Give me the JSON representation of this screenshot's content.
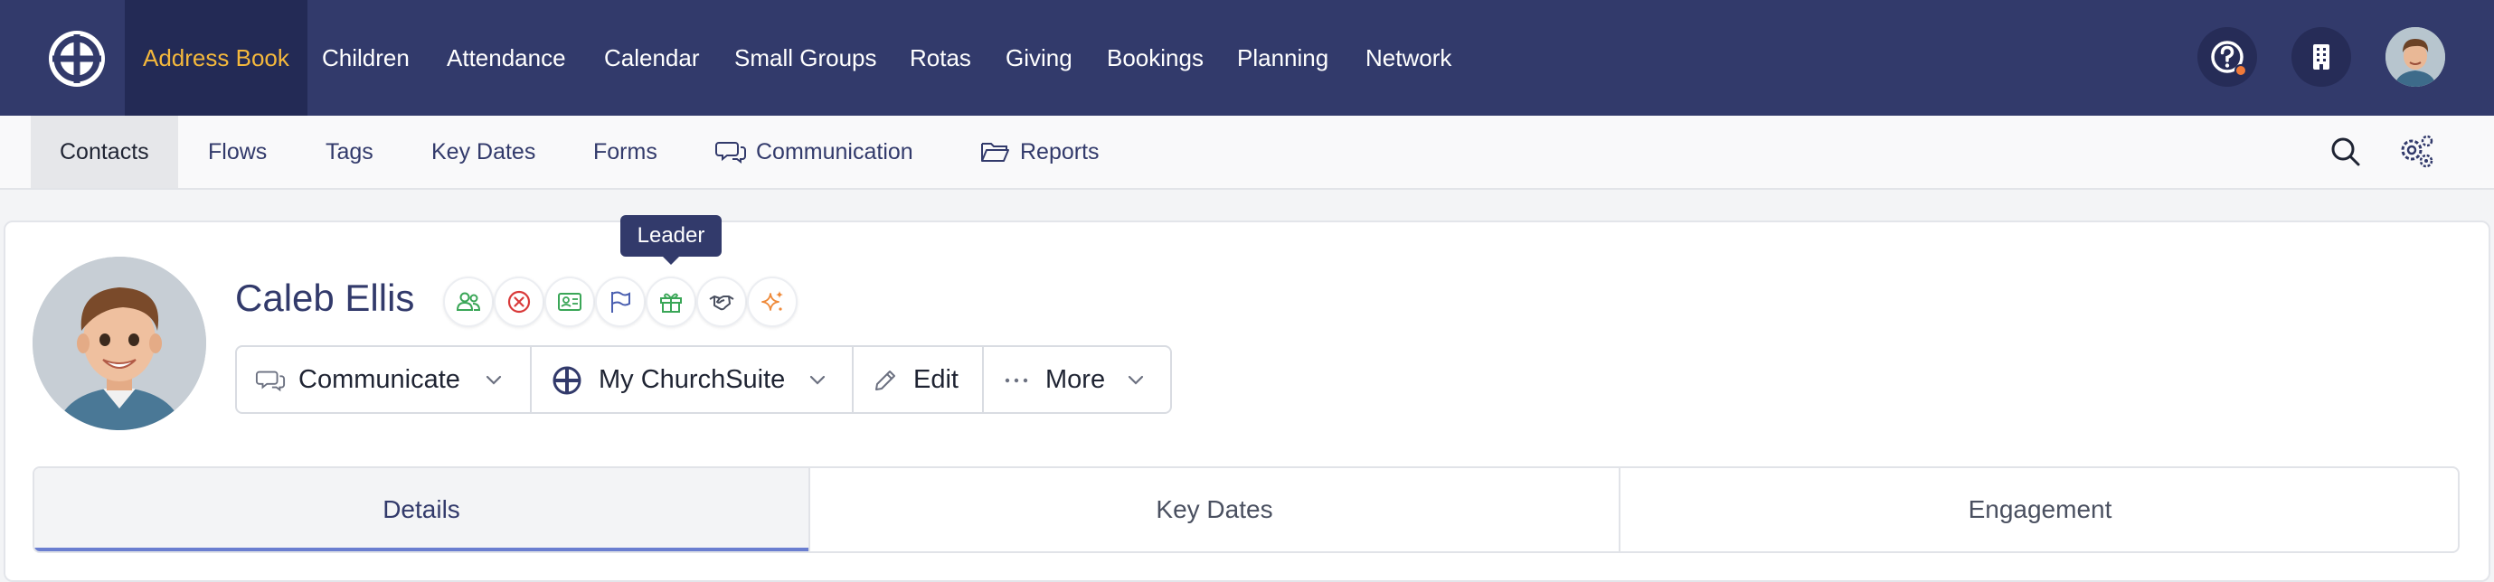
{
  "topnav": {
    "items": [
      {
        "label": "Address Book",
        "active": true
      },
      {
        "label": "Children"
      },
      {
        "label": "Attendance"
      },
      {
        "label": "Calendar"
      },
      {
        "label": "Small Groups"
      },
      {
        "label": "Rotas"
      },
      {
        "label": "Giving"
      },
      {
        "label": "Bookings"
      },
      {
        "label": "Planning"
      },
      {
        "label": "Network"
      }
    ],
    "icons": [
      "help-icon",
      "building-icon",
      "user-avatar"
    ],
    "notification_color": "#f07a3a"
  },
  "subnav": {
    "items": [
      {
        "label": "Contacts",
        "active": true
      },
      {
        "label": "Flows"
      },
      {
        "label": "Tags"
      },
      {
        "label": "Key Dates"
      },
      {
        "label": "Forms"
      },
      {
        "label": "Communication",
        "icon": "chat-icon"
      },
      {
        "label": "Reports",
        "icon": "folder-icon"
      }
    ],
    "right_icons": [
      "search-icon",
      "settings-icon"
    ]
  },
  "profile": {
    "name": "Caleb Ellis",
    "tooltip": "Leader",
    "badges": [
      {
        "icon": "people-icon",
        "color": "#3aa657"
      },
      {
        "icon": "x-circle-icon",
        "color": "#d93a3a"
      },
      {
        "icon": "id-card-icon",
        "color": "#3aa657"
      },
      {
        "icon": "flag-icon",
        "color": "#4a5fb0"
      },
      {
        "icon": "gift-icon",
        "color": "#3aa657"
      },
      {
        "icon": "handshake-icon",
        "color": "#4a5060"
      },
      {
        "icon": "sparkles-icon",
        "color": "#ef8a3a"
      }
    ]
  },
  "actions": {
    "communicate": "Communicate",
    "mychurchsuite": "My ChurchSuite",
    "edit": "Edit",
    "more": "More"
  },
  "tabs": [
    {
      "label": "Details",
      "active": true
    },
    {
      "label": "Key Dates"
    },
    {
      "label": "Engagement"
    }
  ],
  "colors": {
    "primary": "#323a6b",
    "accent": "#f4b83c",
    "tab_indicator": "#6a7ed0"
  }
}
